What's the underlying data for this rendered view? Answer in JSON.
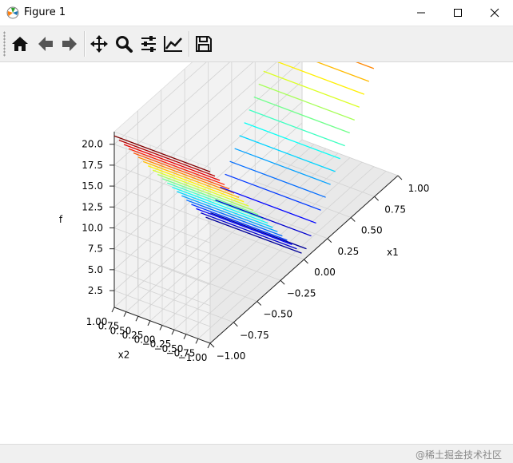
{
  "window": {
    "title": "Figure 1"
  },
  "toolbar": {
    "buttons": [
      {
        "name": "home-icon"
      },
      {
        "name": "back-icon"
      },
      {
        "name": "forward-icon"
      },
      {
        "name": "pan-icon"
      },
      {
        "name": "zoom-icon"
      },
      {
        "name": "configure-subplots-icon"
      },
      {
        "name": "edit-axis-icon"
      },
      {
        "name": "save-icon"
      }
    ]
  },
  "chart_data": {
    "type": "surface",
    "title": "",
    "xlabel": "x1",
    "ylabel": "x2",
    "zlabel": "f",
    "xlim": [
      -1.0,
      1.0
    ],
    "ylim": [
      -1.0,
      1.0
    ],
    "zlim": [
      0.5,
      21.5
    ],
    "colormap": "jet",
    "x_ticks": [
      "−1.00",
      "−0.75",
      "−0.50",
      "−0.25",
      "0.00",
      "0.25",
      "0.50",
      "0.75",
      "1.00"
    ],
    "y_ticks": [
      "1.00",
      "0.75",
      "0.50",
      "0.25",
      "0.00",
      "−0.25",
      "−0.50",
      "−0.75",
      "−1.00"
    ],
    "z_ticks": [
      "2.5",
      "5.0",
      "7.5",
      "10.0",
      "12.5",
      "15.0",
      "17.5",
      "20.0"
    ],
    "z_tick_values": [
      2.5,
      5.0,
      7.5,
      10.0,
      12.5,
      15.0,
      17.5,
      20.0
    ],
    "surface_min": 1.0,
    "surface_max": 21.0,
    "wireframe_lines": 40
  },
  "status": {
    "watermark": "@稀土掘金技术社区"
  },
  "colors": {
    "toolbar_bg": "#f0f0f0",
    "status_bg": "#f0f0f0",
    "pane_bg": "#f2f2f2"
  }
}
